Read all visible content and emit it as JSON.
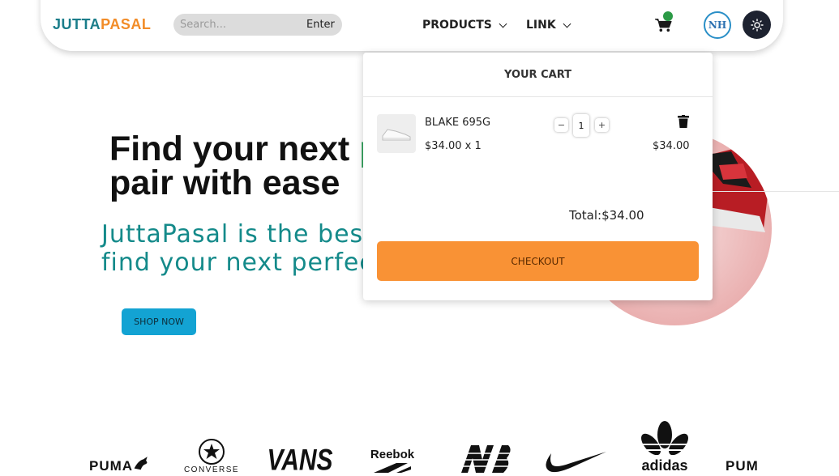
{
  "brand": {
    "part1": "JUTTA",
    "part2": "PASAL"
  },
  "search": {
    "placeholder": "Search...",
    "button_label": "Enter"
  },
  "nav": {
    "products_label": "PRODUCTS",
    "link_label": "LINK"
  },
  "avatar": {
    "initials": "NH"
  },
  "hero": {
    "title_line1_start": "Find your next ",
    "title_line1_highlight": "p",
    "title_line2": "pair with ease",
    "subtitle_line1": "JuttaPasal is the bes",
    "subtitle_line2": "find your next perfect",
    "shop_button": "SHOP NOW"
  },
  "cart": {
    "header": "YOUR CART",
    "items": [
      {
        "name": "BLAKE 695G",
        "price_qty": "$34.00 x 1",
        "quantity": "1",
        "line_total": "$34.00"
      }
    ],
    "qty_minus": "−",
    "qty_plus": "+",
    "total": "Total:$34.00",
    "checkout_label": "CHECKOUT"
  },
  "brands": {
    "puma": "PUMA",
    "converse": "CONVERSE",
    "vans": "VANS",
    "reebok": "Reebok",
    "adidas": "adidas"
  },
  "colors": {
    "accent_orange": "#f28c28",
    "accent_teal": "#1a7d8a",
    "hero_green": "#2ea15a",
    "checkout_orange": "#f99235",
    "shop_blue": "#13a3d3"
  }
}
